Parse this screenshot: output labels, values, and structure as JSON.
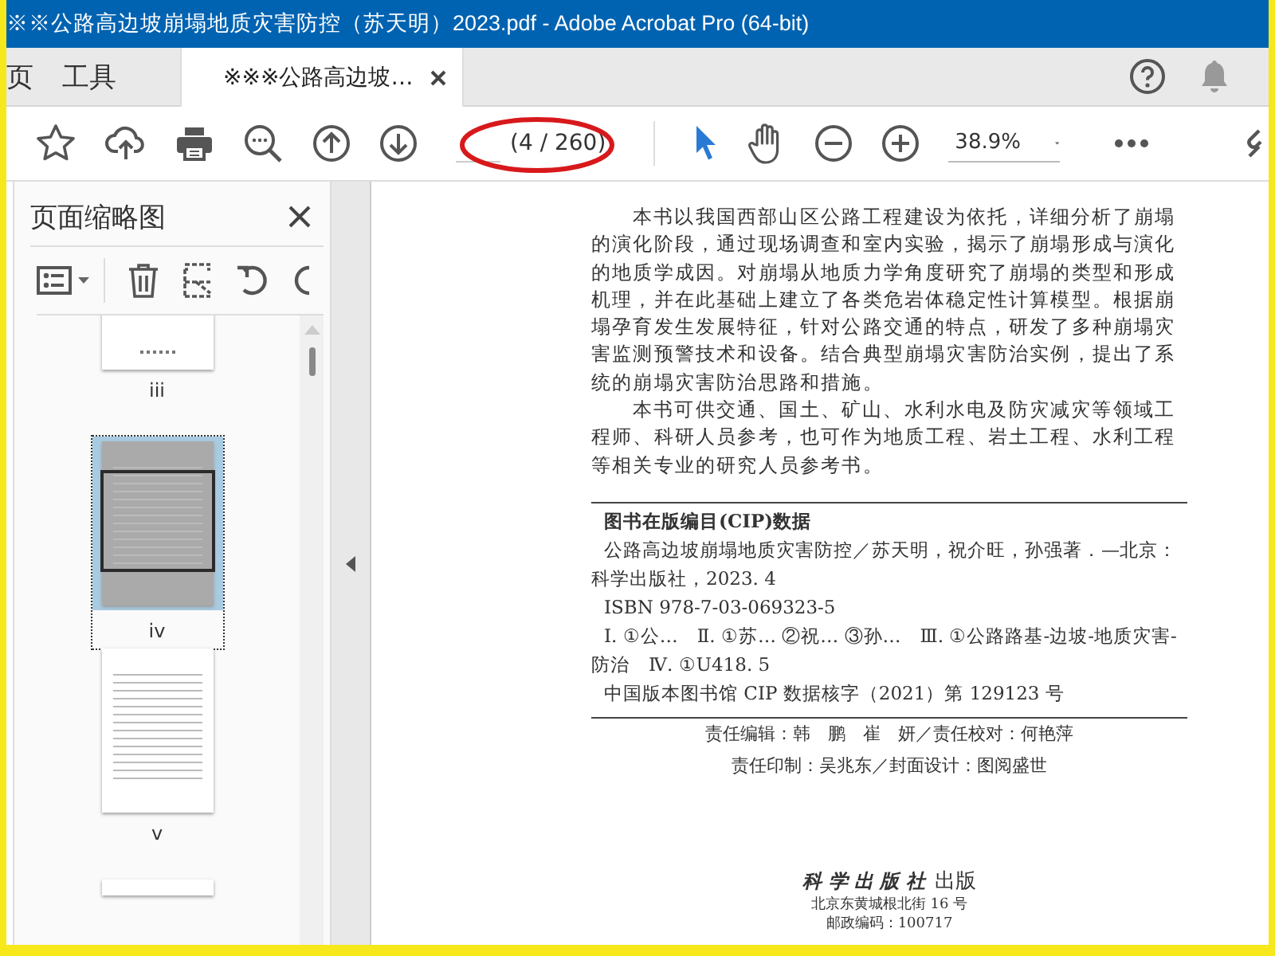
{
  "window": {
    "title": "※※公路高边坡崩塌地质灾害防控（苏天明）2023.pdf - Adobe Acrobat Pro (64-bit)"
  },
  "tabs": [
    {
      "label": "页",
      "selected": false
    },
    {
      "label": "工具",
      "selected": false
    },
    {
      "label": "※※※公路高边坡…",
      "selected": true
    }
  ],
  "toolbar": {
    "page_count": "(4 / 260)",
    "zoom": "38.9%"
  },
  "sidebar": {
    "title": "页面缩略图",
    "thumbnails": [
      {
        "label": "iii",
        "selected": false,
        "kind": "dots"
      },
      {
        "label": "iv",
        "selected": true,
        "kind": "text"
      },
      {
        "label": "v",
        "selected": false,
        "kind": "text"
      },
      {
        "selected": false,
        "kind": "blank"
      }
    ]
  },
  "document": {
    "paragraphs": [
      "本书以我国西部山区公路工程建设为依托，详细分析了崩塌的演化阶段，通过现场调查和室内实验，揭示了崩塌形成与演化的地质学成因。对崩塌从地质力学角度研究了崩塌的类型和形成机理，并在此基础上建立了各类危岩体稳定性计算模型。根据崩塌孕育发生发展特征，针对公路交通的特点，研发了多种崩塌灾害监测预警技术和设备。结合典型崩塌灾害防治实例，提出了系统的崩塌灾害防治思路和措施。",
      "本书可供交通、国土、矿山、水利水电及防灾减灾等领域工程师、科研人员参考，也可作为地质工程、岩土工程、水利工程等相关专业的研究人员参考书。"
    ],
    "cip": {
      "heading": "图书在版编目(CIP)数据",
      "lines": [
        "公路高边坡崩塌地质灾害防控／苏天明，祝介旺，孙强著．—北京：科学出版社，2023. 4",
        "ISBN 978-7-03-069323-5",
        "Ⅰ. ①公…　Ⅱ. ①苏… ②祝… ③孙…　Ⅲ. ①公路路基-边坡-地质灾害-防治　Ⅳ. ①U418. 5",
        "中国版本图书馆 CIP 数据核字（2021）第 129123 号"
      ]
    },
    "credits": [
      "责任编辑：韩　鹏　崔　妍／责任校对：何艳萍",
      "责任印制：吴兆东／封面设计：图阅盛世"
    ],
    "publisher": {
      "name": "科 学 出 版 社",
      "suffix": "出版",
      "address": [
        "北京东黄城根北街 16 号",
        "邮政编码：100717"
      ]
    }
  }
}
